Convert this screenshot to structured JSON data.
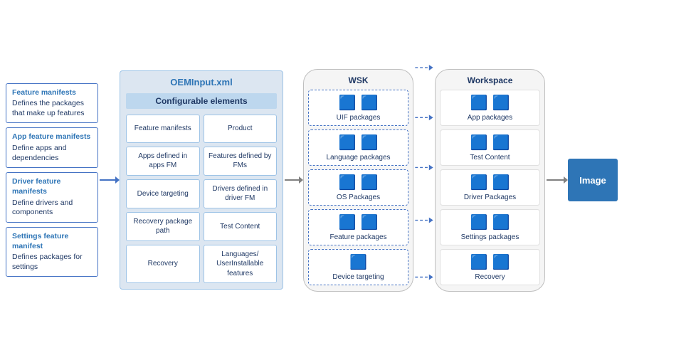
{
  "sidebar": {
    "cards": [
      {
        "title": "Feature manifests",
        "description": "Defines the packages that make up features"
      },
      {
        "title": "App feature manifests",
        "description": "Define apps and dependencies"
      },
      {
        "title": "Driver feature manifests",
        "description": "Define drivers and components"
      },
      {
        "title": "Settings feature manifest",
        "description": "Defines packages for settings"
      }
    ]
  },
  "oeminput": {
    "title": "OEMInput.xml",
    "configurable_label": "Configurable elements",
    "cells": [
      "Feature manifests",
      "Product",
      "Apps defined in apps FM",
      "Features defined by FMs",
      "Device targeting",
      "Drivers defined in driver FM",
      "Recovery package path",
      "Test Content",
      "Recovery",
      "Languages/ UserInstallable features"
    ]
  },
  "wsk": {
    "title": "WSK",
    "items": [
      {
        "label": "UIF packages",
        "icons": [
          "📦",
          "📦"
        ]
      },
      {
        "label": "Language packages",
        "icons": [
          "📦",
          "📦"
        ]
      },
      {
        "label": "OS Packages",
        "icons": [
          "📦",
          "📦"
        ]
      },
      {
        "label": "Feature packages",
        "icons": [
          "📦",
          "📦"
        ]
      },
      {
        "label": "Device targeting",
        "icons": [
          "📦"
        ]
      }
    ]
  },
  "workspace": {
    "title": "Workspace",
    "items": [
      {
        "label": "App packages",
        "icons": [
          "📦",
          "📦"
        ]
      },
      {
        "label": "Test Content",
        "icons": [
          "📦",
          "📦"
        ]
      },
      {
        "label": "Driver Packages",
        "icons": [
          "📦",
          "📦"
        ]
      },
      {
        "label": "Settings packages",
        "icons": [
          "📦",
          "📦"
        ]
      },
      {
        "label": "Recovery",
        "icons": [
          "📦",
          "📦"
        ]
      }
    ]
  },
  "image_label": "Image"
}
